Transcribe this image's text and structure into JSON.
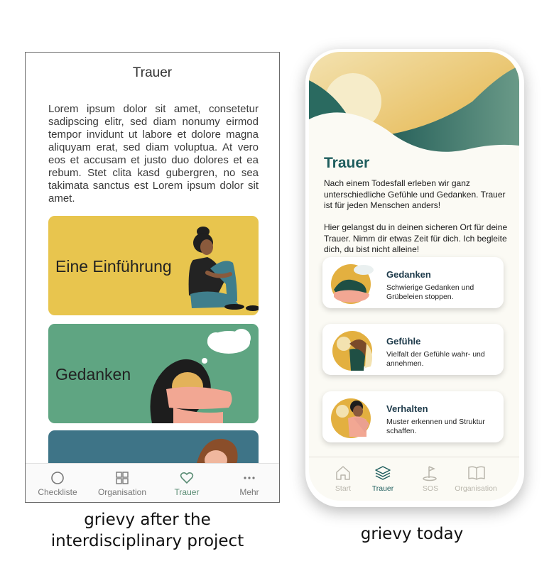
{
  "old_app": {
    "title": "Trauer",
    "body_text": "Lorem ipsum dolor sit amet, consetetur sadipscing elitr, sed diam nonumy eirmod tempor invidunt ut labore et dolore magna aliquyam erat, sed diam voluptua. At vero eos et accusam et justo duo dolores et ea rebum. Stet clita kasd gubergren, no sea takimata sanctus est Lorem ipsum dolor sit amet.",
    "cards": [
      {
        "label": "Eine Einführung",
        "color": "#e8c54e"
      },
      {
        "label": "Gedanken",
        "color": "#5fa582"
      },
      {
        "label": "",
        "color": "#3e7487"
      }
    ],
    "tabs": [
      {
        "label": "Checkliste",
        "icon": "circle-icon"
      },
      {
        "label": "Organisation",
        "icon": "grid-icon"
      },
      {
        "label": "Trauer",
        "icon": "heart-icon",
        "active": true
      },
      {
        "label": "Mehr",
        "icon": "more-dots-icon"
      }
    ]
  },
  "new_app": {
    "title": "Trauer",
    "intro_1": "Nach einem Todesfall erleben wir ganz unterschiedliche Gefühle und Gedanken. Trauer ist für jeden Menschen anders!",
    "intro_2": "Hier gelangst du in deinen sicheren Ort für deine Trauer. Nimm dir etwas Zeit für dich. Ich begleite dich, du bist nicht alleine!",
    "cards": [
      {
        "title": "Gedanken",
        "description": "Schwierige Gedanken und Grübeleien stoppen."
      },
      {
        "title": "Gefühle",
        "description": "Vielfalt der Gefühle wahr- und annehmen."
      },
      {
        "title": "Verhalten",
        "description": "Muster erkennen und Struktur schaffen."
      }
    ],
    "tabs": [
      {
        "label": "Start",
        "icon": "home-icon"
      },
      {
        "label": "Trauer",
        "icon": "layers-icon",
        "active": true
      },
      {
        "label": "SOS",
        "icon": "flag-icon"
      },
      {
        "label": "Organisation",
        "icon": "book-icon"
      }
    ],
    "accent_color": "#1e5d5d"
  },
  "captions": {
    "left": "grievy after the interdisciplinary project",
    "right": "grievy today"
  }
}
